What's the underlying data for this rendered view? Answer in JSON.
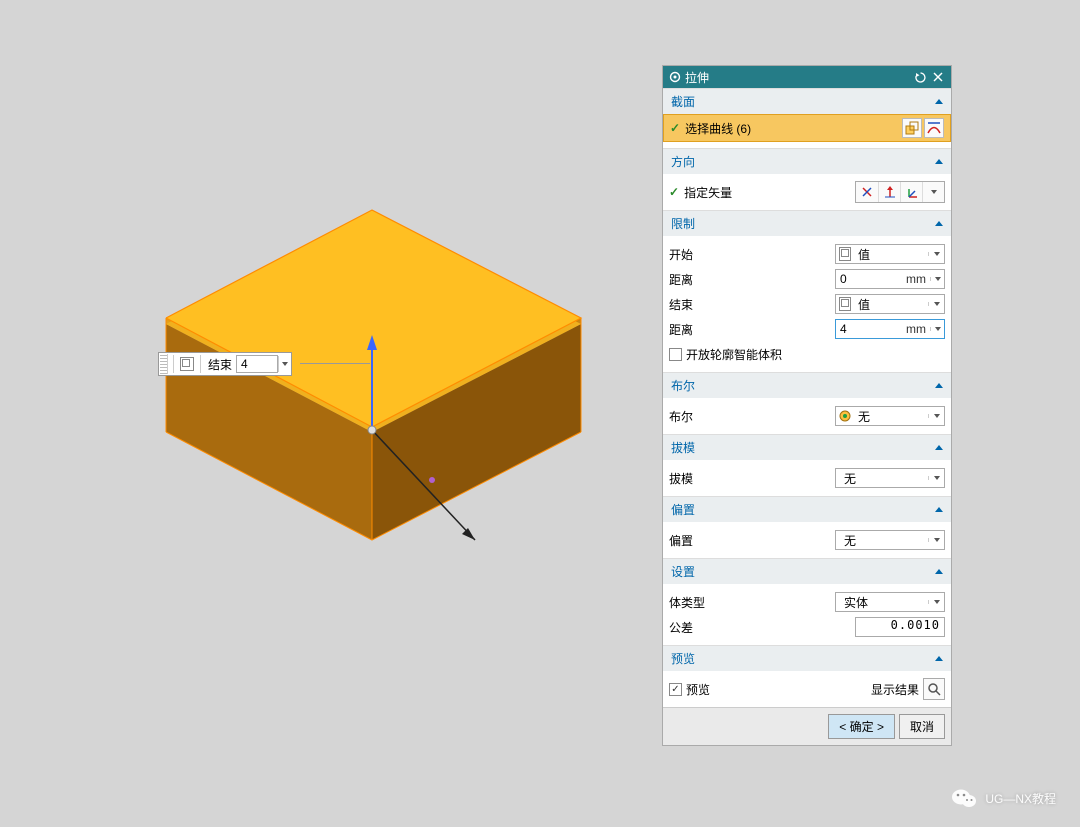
{
  "dialog": {
    "title": "拉伸",
    "sections": {
      "section": {
        "title": "截面",
        "select_curve": "选择曲线 (6)"
      },
      "direction": {
        "title": "方向",
        "specify_vector": "指定矢量"
      },
      "limits": {
        "title": "限制",
        "start_label": "开始",
        "start_value": "值",
        "start_dist_label": "距离",
        "start_dist_value": "0",
        "start_dist_unit": "mm",
        "end_label": "结束",
        "end_value": "值",
        "end_dist_label": "距离",
        "end_dist_value": "4",
        "end_dist_unit": "mm",
        "open_profile": "开放轮廓智能体积"
      },
      "boolean": {
        "title": "布尔",
        "label": "布尔",
        "value": "无"
      },
      "draft": {
        "title": "拔模",
        "label": "拔模",
        "value": "无"
      },
      "offset": {
        "title": "偏置",
        "label": "偏置",
        "value": "无"
      },
      "settings": {
        "title": "设置",
        "body_label": "体类型",
        "body_value": "实体",
        "tol_label": "公差",
        "tol_value": "0.0010"
      },
      "preview": {
        "title": "预览",
        "checkbox": "预览",
        "show_result": "显示结果"
      }
    },
    "buttons": {
      "ok": "< 确定 >",
      "cancel": "取消"
    }
  },
  "float_input": {
    "label": "结束",
    "value": "4"
  },
  "watermark": "UG—NX教程"
}
